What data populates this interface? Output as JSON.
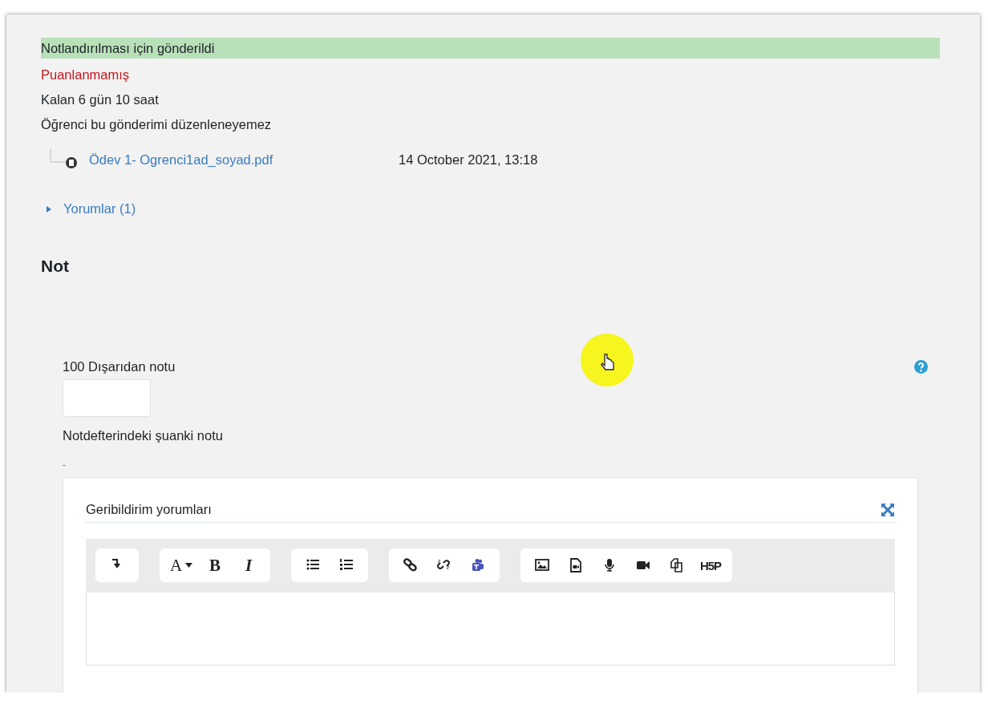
{
  "submission": {
    "status_lines": [
      {
        "text": "Notlandırılması için gönderildi",
        "kind": "success"
      },
      {
        "text": "Puanlanmamış",
        "kind": "danger"
      },
      {
        "text": "Kalan 6 gün 10 saat",
        "kind": "plain"
      },
      {
        "text": "Öğrenci bu gönderimi düzenleneyemez",
        "kind": "plain"
      }
    ],
    "files": [
      {
        "name": "Ödev 1- Ogrenci1ad_soyad.pdf",
        "date": "14 October 2021, 13:18"
      }
    ],
    "comments": {
      "label": "Yorumlar (1)",
      "expanded": false
    }
  },
  "grade": {
    "heading": "Not",
    "field_label": "100 Dışarıdan notu",
    "current_label": "Notdefterindeki şuanki notu",
    "current_value": "-"
  },
  "feedback_editor": {
    "label": "Geribildirim yorumları",
    "toolbar_groups": [
      {
        "buttons": [
          {
            "kind": "collapse"
          }
        ]
      },
      {
        "buttons": [
          {
            "kind": "font",
            "label": "A"
          },
          {
            "kind": "bold",
            "label": "B"
          },
          {
            "kind": "italic",
            "label": "I"
          }
        ]
      },
      {
        "buttons": [
          {
            "kind": "bullets"
          },
          {
            "kind": "numbers"
          }
        ]
      },
      {
        "buttons": [
          {
            "kind": "link"
          },
          {
            "kind": "unlink"
          },
          {
            "kind": "teams"
          }
        ]
      },
      {
        "buttons": [
          {
            "kind": "image"
          },
          {
            "kind": "media"
          },
          {
            "kind": "audio"
          },
          {
            "kind": "video"
          },
          {
            "kind": "files"
          },
          {
            "kind": "h5p",
            "label": "H5P"
          }
        ]
      }
    ]
  }
}
